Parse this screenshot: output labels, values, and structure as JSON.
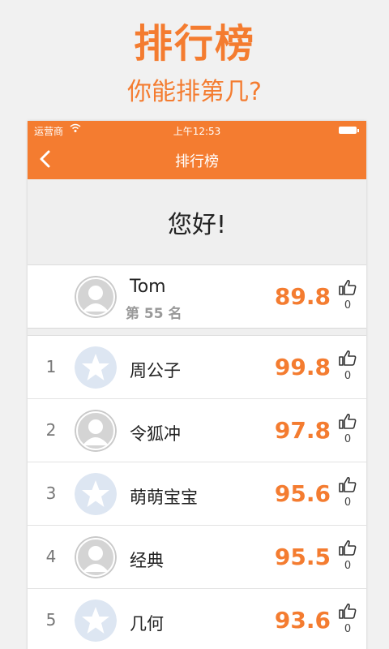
{
  "promo": {
    "title": "排行榜",
    "subtitle": "你能排第几?"
  },
  "status_bar": {
    "carrier": "运营商",
    "time": "上午12:53"
  },
  "nav": {
    "title": "排行榜"
  },
  "greeting": "您好!",
  "me": {
    "name": "Tom",
    "rank_text": "第 55 名",
    "score": "89.8",
    "likes": "0",
    "avatar": "default"
  },
  "rankings": [
    {
      "rank": "1",
      "name": "周公子",
      "score": "99.8",
      "likes": "0",
      "avatar": "star"
    },
    {
      "rank": "2",
      "name": "令狐冲",
      "score": "97.8",
      "likes": "0",
      "avatar": "default"
    },
    {
      "rank": "3",
      "name": "萌萌宝宝",
      "score": "95.6",
      "likes": "0",
      "avatar": "star"
    },
    {
      "rank": "4",
      "name": "经典",
      "score": "95.5",
      "likes": "0",
      "avatar": "default"
    },
    {
      "rank": "5",
      "name": "几何",
      "score": "93.6",
      "likes": "0",
      "avatar": "star"
    }
  ],
  "colors": {
    "accent": "#f47c30",
    "background": "#f1f1f1",
    "avatar_default": "#c9c9c9",
    "avatar_star_bg": "#dde6f2",
    "avatar_star": "#ffffff"
  }
}
